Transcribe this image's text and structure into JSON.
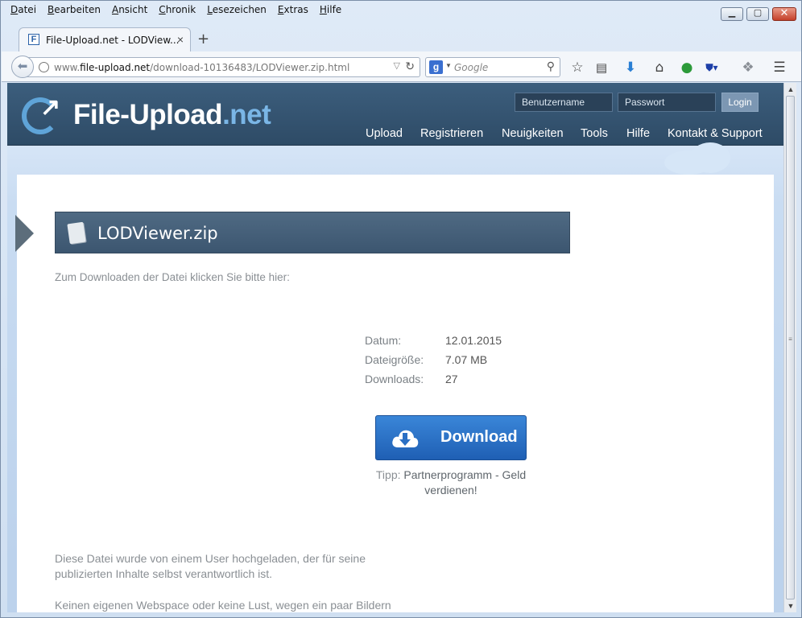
{
  "menubar": {
    "items": [
      {
        "accel": "D",
        "rest": "atei"
      },
      {
        "accel": "B",
        "rest": "earbeiten"
      },
      {
        "accel": "A",
        "rest": "nsicht"
      },
      {
        "accel": "C",
        "rest": "hronik"
      },
      {
        "accel": "L",
        "rest": "esezeichen"
      },
      {
        "accel": "E",
        "rest": "xtras"
      },
      {
        "accel": "H",
        "rest": "ilfe"
      }
    ]
  },
  "window": {
    "minimize_glyph": "▁",
    "maximize_glyph": "▢",
    "close_glyph": "✕"
  },
  "tab": {
    "favicon": "F",
    "title": "File-Upload.net - LODView...",
    "close": "×",
    "new_tab": "+"
  },
  "navbar": {
    "url_prefix": "www.",
    "url_domain": "file-upload.net",
    "url_path": "/download-10136483/LODViewer.zip.html",
    "search_engine": "g",
    "search_placeholder": "Google",
    "icons": {
      "back": "back-arrow-icon",
      "reload": "reload-icon",
      "bookmark": "star-icon",
      "reading": "reading-list-icon",
      "downloads": "download-arrow-icon",
      "home": "home-icon",
      "extension1": "sync-icon",
      "abp": "abe-icon",
      "extension2": "puzzle-icon",
      "menu": "hamburger-icon"
    }
  },
  "site": {
    "logo_main": "File-Upload",
    "logo_tld": ".net",
    "username_placeholder": "Benutzername",
    "password_placeholder": "Passwort",
    "login_label": "Login",
    "nav": [
      "Upload",
      "Registrieren",
      "Neuigkeiten",
      "Tools",
      "Hilfe",
      "Kontakt & Support"
    ]
  },
  "file": {
    "name": "LODViewer.zip",
    "intro": "Zum Downloaden der Datei klicken Sie bitte hier:",
    "info": [
      {
        "label": "Datum:",
        "value": "12.01.2015"
      },
      {
        "label": "Dateigröße:",
        "value": "7.07 MB"
      },
      {
        "label": "Downloads:",
        "value": "27"
      }
    ],
    "download_label": "Download",
    "tip_prefix": "Tipp:",
    "tip_link": "Partnerprogramm - Geld verdienen!"
  },
  "disclaimer": {
    "line1": "Diese Datei wurde von einem User hochgeladen, der für seine",
    "line2": "publizierten Inhalte selbst verantwortlich ist.",
    "line3": "Keinen eigenen Webspace oder keine Lust, wegen ein paar Bildern"
  },
  "colors": {
    "header": "#34536f",
    "accent": "#5fa4d8",
    "download_button": "#2a72c6"
  }
}
